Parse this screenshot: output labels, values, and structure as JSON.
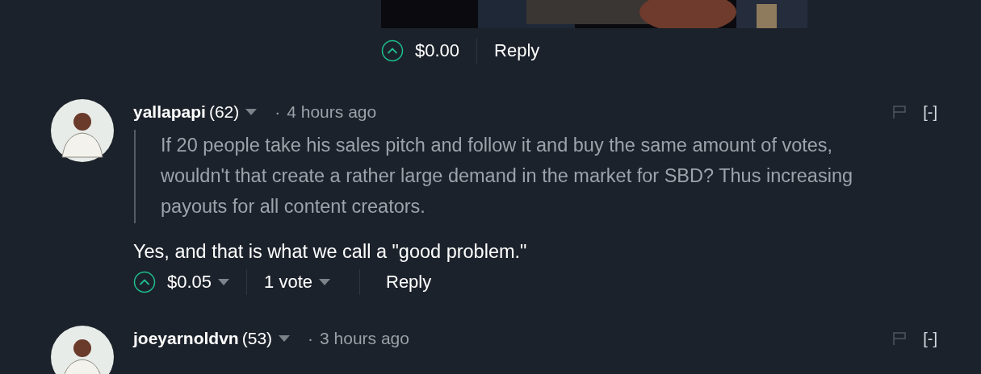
{
  "top_post": {
    "payout": "$0.00",
    "reply": "Reply"
  },
  "comments": [
    {
      "author": "yallapapi",
      "reputation": "(62)",
      "separator": "·",
      "time": "4 hours ago",
      "collapse": "[-]",
      "quote": "If 20 people take his sales pitch and follow it and buy the same amount of votes, wouldn't that create a rather large demand in the market for SBD? Thus increasing payouts for all content creators.",
      "body": "Yes, and that is what we call a \"good problem.\"",
      "payout": "$0.05",
      "votes": "1 vote",
      "reply": "Reply"
    },
    {
      "author": "joeyarnoldvn",
      "reputation": "(53)",
      "separator": "·",
      "time": "3 hours ago",
      "collapse": "[-]"
    }
  ]
}
